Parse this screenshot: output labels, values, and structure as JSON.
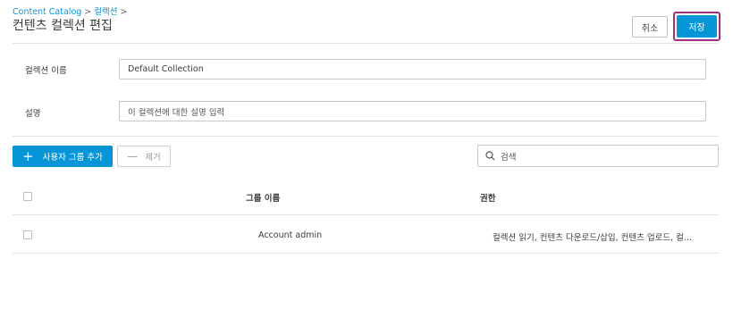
{
  "breadcrumb": {
    "root": "Content Catalog",
    "sep1": ">",
    "current": "컬렉션",
    "sep2": ">"
  },
  "page_title": "컨텐츠 컬렉션 편집",
  "actions": {
    "cancel_label": "취소",
    "save_label": "저장"
  },
  "form": {
    "name_label": "컬렉션 이름",
    "name_value": "Default Collection",
    "desc_label": "설명",
    "desc_placeholder": "이 컬렉션에 대한 설명 입력"
  },
  "toolbar": {
    "add_plus": "+",
    "add_label": "사용자 그룹 추가",
    "remove_minus": "—",
    "remove_label": "제거"
  },
  "search": {
    "placeholder": "검색"
  },
  "table": {
    "columns": [
      "그룹 이름",
      "권한"
    ],
    "rows": [
      {
        "group": "Account admin",
        "permission": "컬렉션 읽기, 컨텐츠 다운로드/삽입, 컨텐츠 업로드, 컬..."
      }
    ]
  },
  "colors": {
    "accent": "#0696d7",
    "highlight": "#a1307f"
  }
}
